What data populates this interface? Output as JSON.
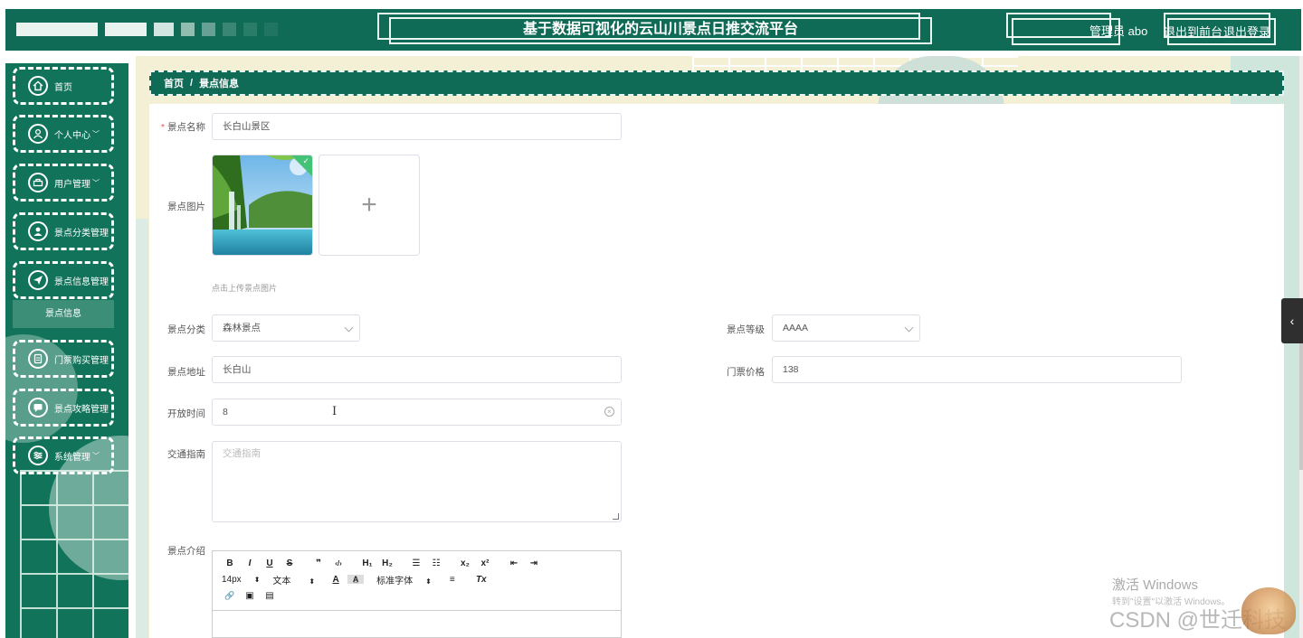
{
  "header": {
    "title": "基于数据可视化的云山川景点日推交流平台",
    "user_text": "管理员 abo",
    "to_front_label": "退出到前台",
    "logout_label": "退出登录"
  },
  "sidebar": {
    "items": [
      {
        "label": "首页",
        "icon": "home-icon"
      },
      {
        "label": "个人中心",
        "icon": "user-icon",
        "arrow": "﹀"
      },
      {
        "label": "用户管理",
        "icon": "users-icon",
        "arrow": "﹀"
      },
      {
        "label": "景点分类管理",
        "icon": "category-icon"
      },
      {
        "label": "景点信息管理",
        "icon": "send-icon"
      },
      {
        "label": "门票购买管理",
        "icon": "ticket-icon"
      },
      {
        "label": "景点攻略管理",
        "icon": "chat-icon"
      },
      {
        "label": "系统管理",
        "icon": "settings-icon",
        "arrow": "﹀"
      }
    ],
    "active_sub": "景点信息"
  },
  "breadcrumb": {
    "home": "首页",
    "separator": "/",
    "current": "景点信息"
  },
  "form": {
    "name": {
      "label": "景点名称",
      "value": "长白山景区",
      "required": "*"
    },
    "image": {
      "label": "景点图片",
      "hint": "点击上传景点图片",
      "plus": "+"
    },
    "category": {
      "label": "景点分类",
      "value": "森林景点"
    },
    "level": {
      "label": "景点等级",
      "value": "AAAA"
    },
    "address": {
      "label": "景点地址",
      "value": "长白山"
    },
    "price": {
      "label": "门票价格",
      "value": "138"
    },
    "open_time": {
      "label": "开放时间",
      "value": "8",
      "clear": "⊗"
    },
    "traffic": {
      "label": "交通指南",
      "placeholder": "交通指南"
    },
    "intro": {
      "label": "景点介绍"
    }
  },
  "editor": {
    "row1": [
      "B",
      "I",
      "U",
      "S",
      "❞",
      "‹/›",
      "H₁",
      "H₂",
      "☰",
      "☷",
      "x₂",
      "x²",
      "⇤",
      "⇥"
    ],
    "font_size": "14px",
    "text_type": "文本",
    "font_family": "标准字体",
    "row2_icons": [
      "A",
      "A̲",
      "≡",
      "Tx"
    ],
    "row3": [
      "🔗",
      "▣",
      "▤"
    ]
  },
  "overlay": {
    "activate_title": "激活 Windows",
    "activate_sub": "转到\"设置\"以激活 Windows。",
    "csdn": "CSDN @世迁科技",
    "toggle": "‹"
  },
  "colors": {
    "primary": "#0f6b55",
    "sidebar": "#11735a",
    "background": "#f3f0d6"
  }
}
